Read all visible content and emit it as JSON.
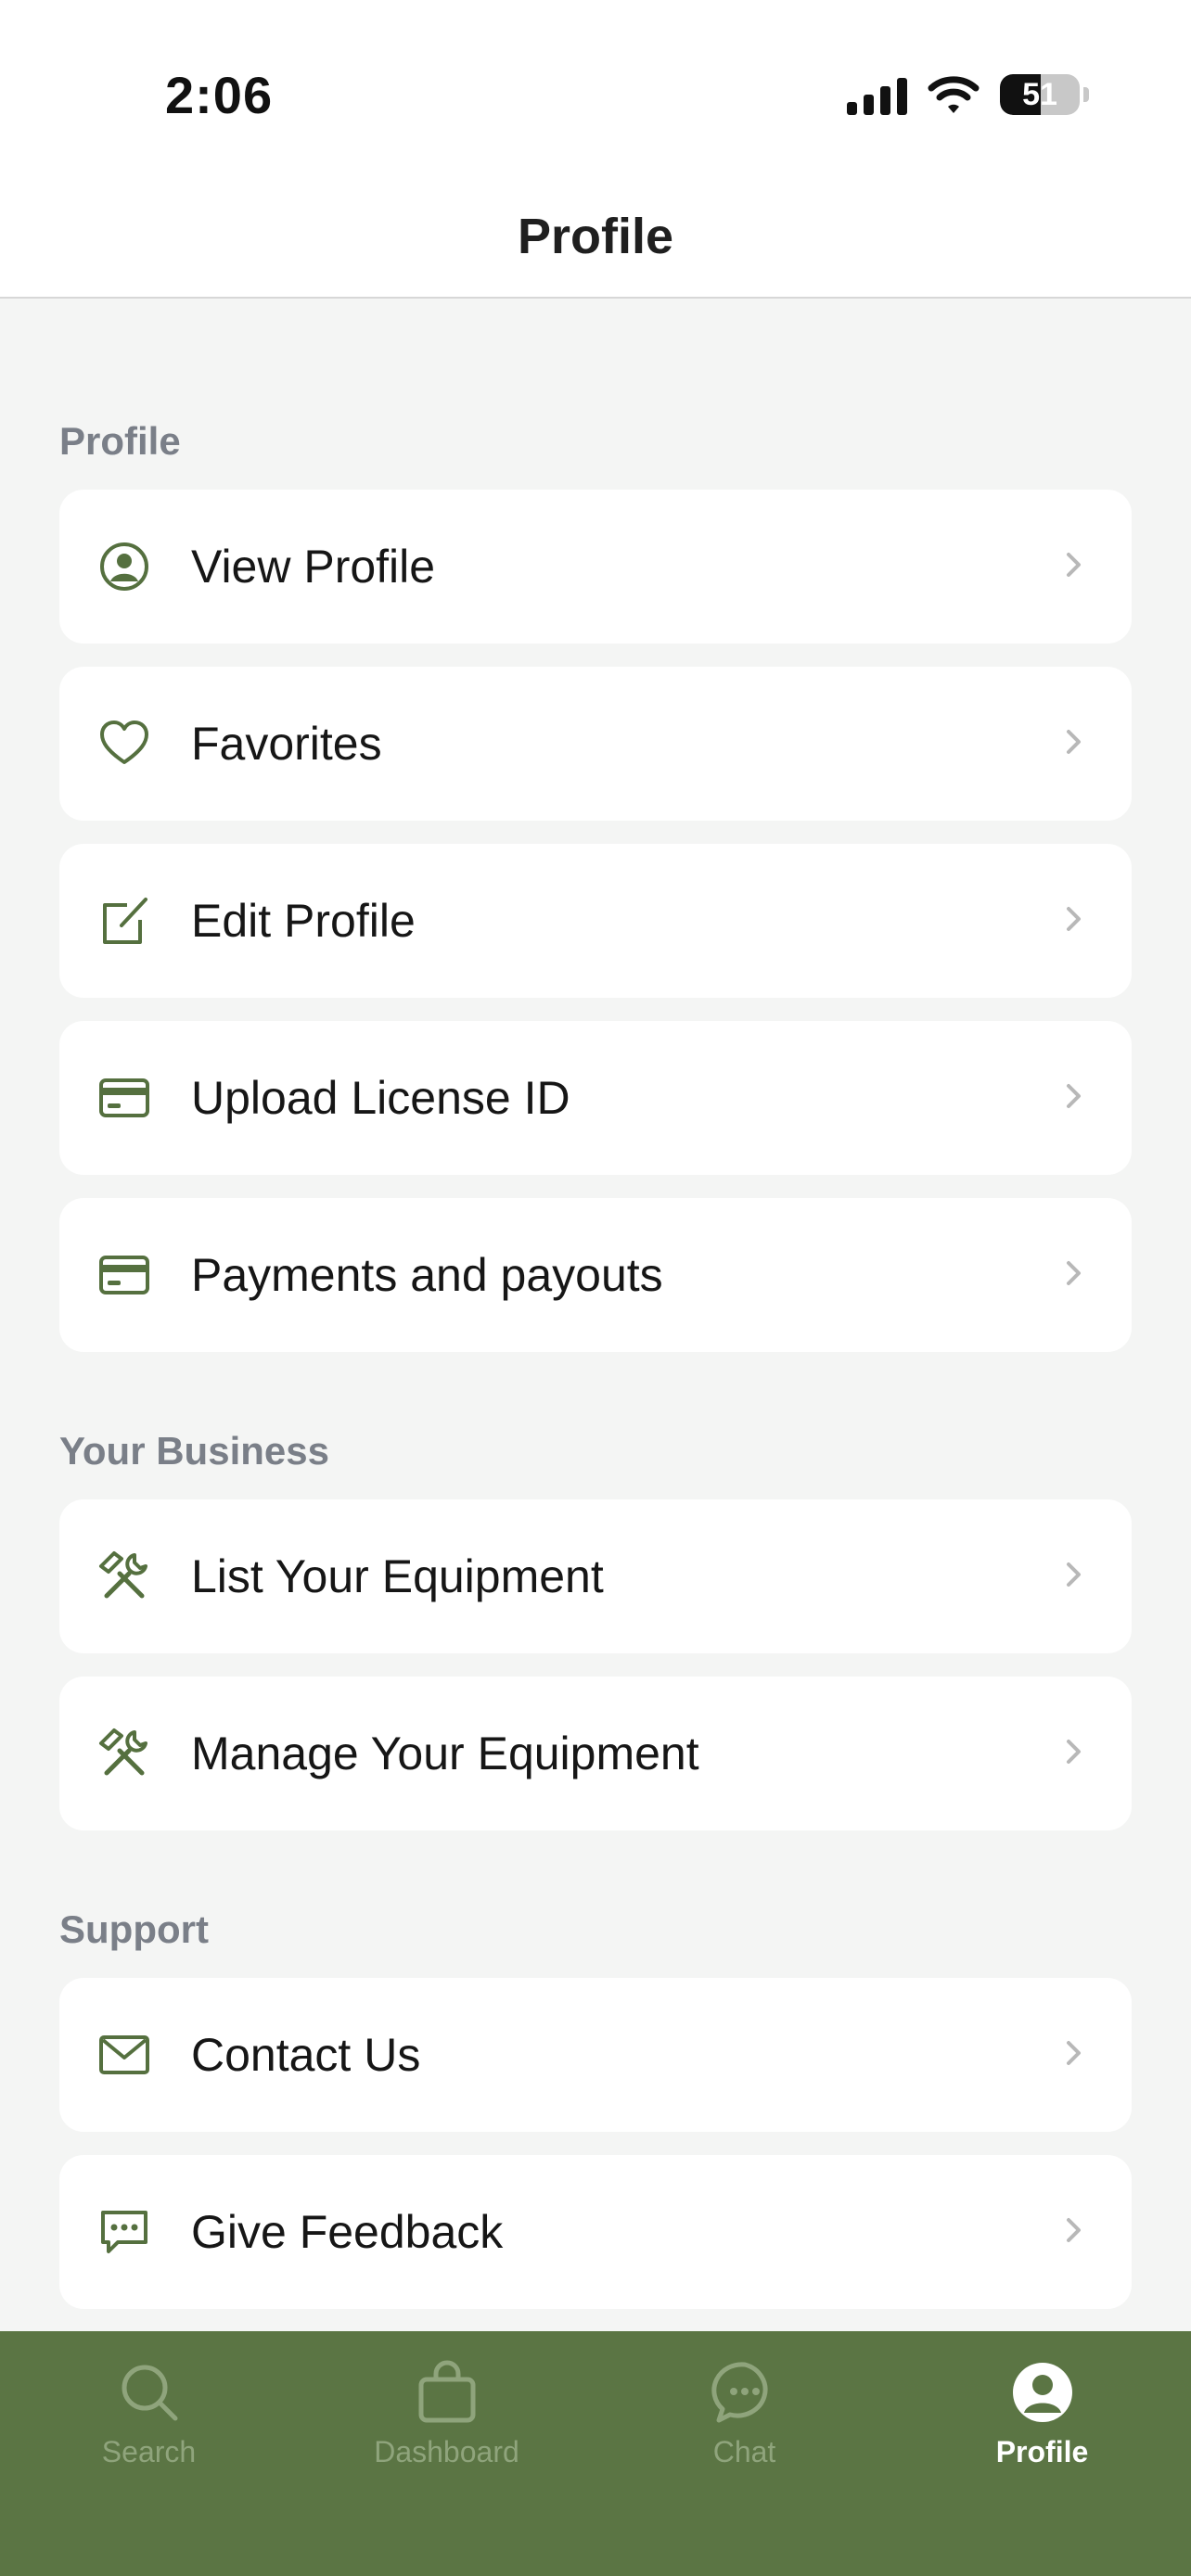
{
  "status_bar": {
    "time": "2:06",
    "battery": "51",
    "battery_level": 0.51
  },
  "header": {
    "title": "Profile"
  },
  "colors": {
    "accent": "#5b7544",
    "icon": "#55703f",
    "section_title": "#7a7f88",
    "chevron": "#b8b8b8"
  },
  "sections": [
    {
      "title": "Profile",
      "items": [
        {
          "label": "View Profile",
          "icon": "user-circle-icon"
        },
        {
          "label": "Favorites",
          "icon": "heart-icon"
        },
        {
          "label": "Edit Profile",
          "icon": "edit-icon"
        },
        {
          "label": "Upload License ID",
          "icon": "card-icon"
        },
        {
          "label": "Payments and payouts",
          "icon": "card-icon"
        }
      ]
    },
    {
      "title": "Your Business",
      "items": [
        {
          "label": "List Your Equipment",
          "icon": "tools-icon"
        },
        {
          "label": "Manage Your Equipment",
          "icon": "tools-icon"
        }
      ]
    },
    {
      "title": "Support",
      "items": [
        {
          "label": "Contact Us",
          "icon": "mail-icon"
        },
        {
          "label": "Give Feedback",
          "icon": "chat-bubble-icon"
        }
      ]
    }
  ],
  "tabs": [
    {
      "label": "Search",
      "icon": "search-icon",
      "active": false
    },
    {
      "label": "Dashboard",
      "icon": "bag-icon",
      "active": false
    },
    {
      "label": "Chat",
      "icon": "chat-icon",
      "active": false
    },
    {
      "label": "Profile",
      "icon": "profile-icon",
      "active": true
    }
  ]
}
